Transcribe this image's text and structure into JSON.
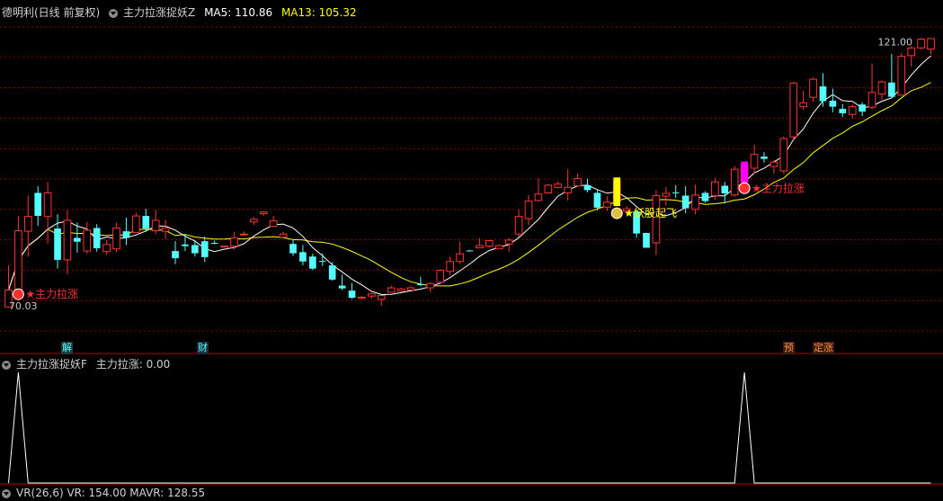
{
  "header": {
    "stock_label": "德明利(日线 前复权)",
    "indicator_name": "主力拉涨捉妖Z",
    "ma5_label": "MA5: 110.86",
    "ma13_label": "MA13: 105.32"
  },
  "subpanel": {
    "indicator_name": "主力拉涨捉妖F",
    "value_label": "主力拉涨: 0.00"
  },
  "bottom_strip": {
    "text": "VR(26,6) VR: 154.00 MAVR: 128.55"
  },
  "tags": {
    "jie": "解",
    "cai": "财",
    "yu": "预",
    "dingzhang": "定涨"
  },
  "colors": {
    "up": "#ff3232",
    "down": "#54ffff",
    "ma5": "#ffffff",
    "ma13": "#ffff00",
    "signal_yellow": "#ffff00",
    "signal_magenta": "#ff00ff",
    "annotation_red": "#ff3030",
    "annotation_yellow": "#ffff00",
    "grid": "#8b0000",
    "label_cyan": "#54ffff",
    "label_orange": "#ff8a3a"
  },
  "chart_data": [
    {
      "type": "candlestick",
      "title": "德明利(日线 前复权)",
      "ylim": [
        66,
        124
      ],
      "price_labels": {
        "high": "121.00",
        "low": "70.03"
      },
      "annotations": [
        {
          "text": "★主力拉涨",
          "bar_index": 1
        },
        {
          "text": "★妖股起飞",
          "bar_index": 62
        },
        {
          "text": "★主力拉涨",
          "bar_index": 75
        }
      ],
      "series_ma": [
        "MA5",
        "MA13"
      ],
      "ohlc": [
        [
          72.0,
          79.6,
          72.2,
          75.1
        ],
        [
          75.0,
          88.6,
          75.0,
          85.9
        ],
        [
          85.8,
          92.3,
          81.2,
          88.5
        ],
        [
          92.8,
          94.0,
          86.8,
          88.6
        ],
        [
          88.5,
          94.8,
          83.5,
          92.8
        ],
        [
          86.3,
          88.9,
          79.0,
          80.6
        ],
        [
          80.6,
          89.7,
          78.0,
          87.8
        ],
        [
          84.6,
          87.4,
          81.9,
          83.9
        ],
        [
          82.2,
          87.5,
          81.7,
          86.0
        ],
        [
          86.4,
          87.1,
          82.1,
          82.7
        ],
        [
          82.1,
          84.2,
          81.5,
          83.4
        ],
        [
          82.6,
          87.4,
          82.0,
          86.4
        ],
        [
          85.8,
          88.3,
          83.3,
          84.6
        ],
        [
          85.6,
          89.2,
          85.6,
          88.6
        ],
        [
          88.6,
          89.9,
          85.7,
          86.3
        ],
        [
          85.9,
          89.7,
          85.3,
          87.8
        ],
        [
          85.8,
          87.9,
          84.4,
          86.4
        ],
        [
          82.2,
          84.0,
          79.8,
          80.9
        ],
        [
          83.4,
          85.3,
          82.2,
          83.1
        ],
        [
          83.3,
          84.2,
          81.2,
          81.8
        ],
        [
          84.0,
          84.8,
          80.2,
          81.1
        ],
        [
          83.7,
          84.1,
          83.4,
          83.6
        ],
        [
          83.1,
          83.2,
          83.0,
          83.1
        ],
        [
          83.1,
          85.7,
          82.5,
          84.6
        ],
        [
          85.2,
          85.8,
          85.0,
          85.3
        ],
        [
          87.5,
          88.4,
          86.9,
          88.0
        ],
        [
          89.0,
          89.5,
          88.6,
          89.3
        ],
        [
          86.7,
          88.6,
          86.6,
          87.7
        ],
        [
          84.7,
          85.7,
          84.5,
          85.3
        ],
        [
          83.5,
          84.4,
          81.3,
          81.8
        ],
        [
          82.0,
          83.3,
          79.6,
          80.3
        ],
        [
          81.2,
          81.7,
          78.7,
          79.0
        ],
        [
          80.4,
          81.8,
          79.5,
          80.3
        ],
        [
          79.6,
          80.2,
          76.8,
          77.0
        ],
        [
          75.9,
          77.9,
          75.1,
          75.4
        ],
        [
          75.0,
          76.4,
          73.5,
          73.7
        ],
        [
          73.7,
          74.0,
          73.6,
          73.8
        ],
        [
          74.0,
          74.6,
          73.5,
          74.4
        ],
        [
          73.4,
          74.1,
          72.2,
          74.1
        ],
        [
          74.7,
          75.9,
          74.6,
          75.5
        ],
        [
          74.9,
          75.5,
          74.9,
          75.3
        ],
        [
          75.1,
          75.8,
          75.1,
          75.5
        ],
        [
          76.2,
          77.5,
          75.8,
          76.0
        ],
        [
          75.5,
          76.5,
          74.7,
          76.3
        ],
        [
          76.5,
          78.9,
          76.1,
          78.7
        ],
        [
          78.5,
          81.2,
          77.9,
          80.3
        ],
        [
          80.3,
          83.9,
          79.9,
          81.7
        ],
        [
          82.3,
          82.4,
          82.2,
          82.2
        ],
        [
          82.8,
          84.6,
          82.7,
          83.2
        ],
        [
          83.1,
          84.2,
          82.8,
          84.1
        ],
        [
          82.6,
          83.4,
          82.6,
          83.2
        ],
        [
          83.5,
          84.6,
          82.1,
          84.2
        ],
        [
          85.3,
          89.8,
          84.8,
          88.5
        ],
        [
          88.1,
          92.4,
          86.9,
          91.3
        ],
        [
          91.4,
          95.5,
          91.2,
          92.6
        ],
        [
          92.8,
          94.4,
          92.6,
          94.2
        ],
        [
          93.8,
          94.9,
          93.6,
          94.4
        ],
        [
          92.8,
          97.1,
          91.4,
          93.8
        ],
        [
          94.1,
          96.3,
          94.0,
          95.4
        ],
        [
          94.2,
          95.4,
          92.9,
          93.3
        ],
        [
          92.8,
          93.3,
          89.6,
          90.1
        ],
        [
          90.2,
          92.2,
          89.5,
          91.1
        ],
        [
          91.3,
          95.6,
          90.4,
          95.0
        ],
        [
          89.5,
          90.4,
          88.7,
          89.9
        ],
        [
          89.4,
          89.6,
          84.6,
          85.4
        ],
        [
          85.5,
          85.5,
          82.8,
          82.8
        ],
        [
          83.7,
          93.3,
          81.5,
          92.3
        ],
        [
          92.2,
          93.9,
          90.5,
          92.7
        ],
        [
          92.9,
          94.2,
          91.9,
          92.8
        ],
        [
          92.3,
          94.0,
          89.1,
          90.0
        ],
        [
          89.8,
          94.3,
          88.9,
          92.4
        ],
        [
          92.8,
          93.1,
          91.0,
          91.3
        ],
        [
          92.3,
          95.5,
          91.5,
          94.8
        ],
        [
          94.1,
          94.8,
          90.9,
          92.7
        ],
        [
          92.4,
          97.7,
          92.1,
          97.1
        ],
        [
          94.9,
          98.5,
          94.3,
          97.8
        ],
        [
          97.3,
          101.6,
          96.2,
          99.8
        ],
        [
          99.4,
          100.2,
          98.3,
          99.0
        ],
        [
          97.6,
          98.8,
          96.3,
          98.4
        ],
        [
          96.8,
          103.1,
          96.3,
          102.7
        ],
        [
          103.0,
          113.0,
          102.5,
          112.8
        ],
        [
          108.5,
          111.4,
          107.9,
          109.2
        ],
        [
          110.2,
          113.8,
          109.4,
          113.5
        ],
        [
          112.2,
          114.6,
          108.5,
          109.5
        ],
        [
          109.6,
          111.8,
          107.5,
          108.5
        ],
        [
          108.1,
          109.0,
          106.6,
          107.3
        ],
        [
          107.1,
          108.8,
          106.3,
          108.5
        ],
        [
          108.9,
          109.3,
          106.8,
          107.6
        ],
        [
          108.4,
          116.4,
          108.0,
          111.1
        ],
        [
          110.8,
          113.3,
          109.8,
          113.0
        ],
        [
          112.9,
          118.1,
          110.0,
          110.3
        ],
        [
          110.6,
          118.3,
          110.6,
          117.7
        ],
        [
          117.8,
          119.5,
          115.8,
          119.2
        ],
        [
          119.2,
          121.0,
          119.0,
          120.8
        ],
        [
          119.0,
          121.0,
          118.0,
          120.9
        ]
      ]
    },
    {
      "type": "line",
      "title": "主力拉涨捉妖F",
      "series": [
        {
          "name": "主力拉涨",
          "values_description": "spikes to 1 at signal bars, 0 elsewhere"
        }
      ],
      "spike_indices": [
        1,
        75
      ],
      "ylim": [
        0,
        1
      ]
    }
  ]
}
